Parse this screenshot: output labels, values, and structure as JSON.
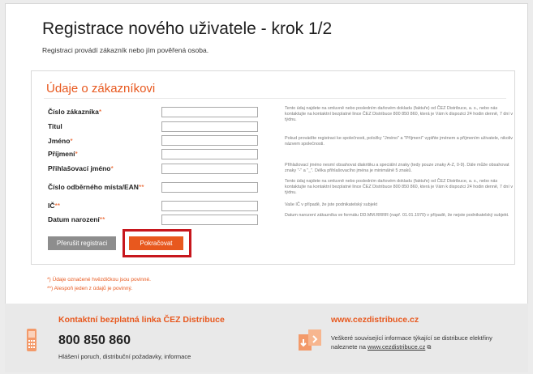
{
  "page": {
    "title": "Registrace nového uživatele - krok 1/2",
    "subtitle": "Registraci provádí zákazník nebo jím pověřená osoba."
  },
  "form": {
    "section_title": "Údaje o zákazníkovi",
    "fields": [
      {
        "label": "Číslo zákazníka",
        "marker": "*",
        "value": ""
      },
      {
        "label": "Titul",
        "marker": "",
        "value": ""
      },
      {
        "label": "Jméno",
        "marker": "*",
        "value": ""
      },
      {
        "label": "Příjmení",
        "marker": "*",
        "value": ""
      },
      {
        "label": "Přihlašovací jméno",
        "marker": "*",
        "value": ""
      },
      {
        "label": "Číslo odběrného místa/EAN",
        "marker": "**",
        "value": ""
      },
      {
        "label": "IČ",
        "marker": "**",
        "value": ""
      },
      {
        "label": "Datum narození",
        "marker": "**",
        "value": ""
      }
    ],
    "hints": {
      "customer_number": "Tento údaj najdete na smluvně nebo posledním daňovém dokladu (faktuře) od ČEZ Distribuce, a. s., nebo nás kontaktujte na kontaktní bezplatné lince ČEZ Distribuce 800 850 860, která je Vám k dispozici 24 hodin denně, 7 dní v týdnu.",
      "name": "Pokud provádíte registraci ke společnosti, položky \"Jméno\" a \"Příjmení\" vyplňte jménem a příjmením uživatele, nikoliv názvem společnosti.",
      "login": "Přihlašovací jméno nesmí obsahovat diakritiku a speciální znaky (tedy pouze znaky A-Z, 0-9). Dále může obsahovat znaky \"-\" a \"_\". Délka přihlašovacího jména je minimálně 5 znaků.",
      "ean": "Tento údaj najdete na smluvně nebo posledním daňovém dokladu (faktuře) od ČEZ Distribuce, a. s., nebo nás kontaktujte na kontaktní bezplatné lince ČEZ Distribuce 800 850 860, která je Vám k dispozici 24 hodin denně, 7 dní v týdnu.",
      "ico": "Vaše IČ v případě, že jste podnikatelský subjekt",
      "birth": "Datum narození zákazníka ve formátu DD.MM.RRRR (např. 01.01.1970) v případě, že nejste podnikatelský subjekt."
    },
    "cancel_label": "Přerušit registraci",
    "continue_label": "Pokračovat"
  },
  "notes": {
    "required": "*) Údaje označené hvězdičkou jsou povinné.",
    "at_least_one": "**) Alespoň jeden z údajů je povinný."
  },
  "footer": {
    "hotline_title": "Kontaktní bezplatná linka ČEZ Distribuce",
    "phone": "800 850 860",
    "hotline_text": "Hlášení poruch, distribuční požadavky, informace",
    "web_title": "www.cezdistribuce.cz",
    "web_text": "Veškeré související informace týkající se distribuce elektřiny naleznete na",
    "web_link": "www.cezdistribuce.cz"
  },
  "colors": {
    "accent": "#e8581e",
    "highlight": "#c7161d",
    "button_grey": "#8d8d8d"
  }
}
